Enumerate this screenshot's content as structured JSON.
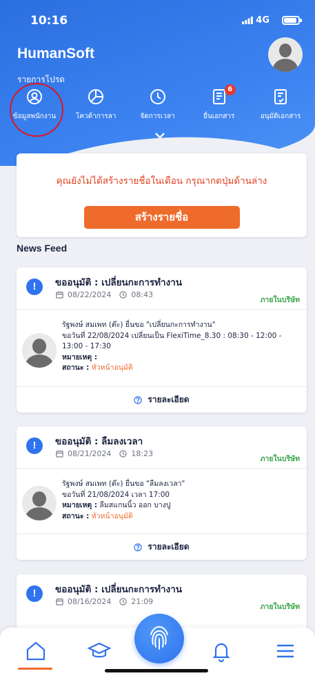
{
  "status_bar": {
    "time": "10:16",
    "network": "4G"
  },
  "header": {
    "brand": "HumanSoft",
    "favorites_label": "รายการโปรด",
    "shortcuts": [
      {
        "label": "ข้อมูลพนักงาน",
        "icon": "user-circle-icon"
      },
      {
        "label": "โควต้าการลา",
        "icon": "pie-chart-icon"
      },
      {
        "label": "จัดการเวลา",
        "icon": "clock-icon"
      },
      {
        "label": "ยื่นเอกสาร",
        "icon": "document-icon",
        "badge": "6"
      },
      {
        "label": "อนุมัติเอกสาร",
        "icon": "approve-document-icon"
      }
    ],
    "expand_icon": "chevron-down-icon"
  },
  "notice": {
    "message": "คุณยังไม่ได้สร้างรายชื่อในเดือน กรุณากดปุ่มด้านล่าง",
    "button": "สร้างรายชื่อ"
  },
  "news_feed": {
    "title": "News Feed",
    "items": [
      {
        "title": "ขออนุมัติ : เปลี่ยนกะการทำงาน",
        "date": "08/22/2024",
        "time": "08:43",
        "tag": "ภายในบริษัท",
        "line1": "รัฐพงษ์ สมเพท (ต๊ะ) ยื่นขอ \"เปลี่ยนกะการทำงาน\"",
        "line2": "ขอวันที่ 22/08/2024 เปลี่ยนเป็น FlexiTime_8.30 : 08:30 - 12:00 - 13:00 - 17:30",
        "remark_label": "หมายเหตุ :",
        "remark_value": "",
        "status_label": "สถานะ :",
        "status_value": "หัวหน้าอนุมัติ",
        "details": "รายละเอียด"
      },
      {
        "title": "ขออนุมัติ : ลืมลงเวลา",
        "date": "08/21/2024",
        "time": "18:23",
        "tag": "ภายในบริษัท",
        "line1": "รัฐพงษ์ สมเพท (ต๊ะ) ยื่นขอ \"ลืมลงเวลา\"",
        "line2": "ขอวันที่ 21/08/2024 เวลา 17:00",
        "remark_label": "หมายเหตุ :",
        "remark_value": "ลืมสแกนนิ้ว ออก บางปู",
        "status_label": "สถานะ :",
        "status_value": "หัวหน้าอนุมัติ",
        "details": "รายละเอียด"
      },
      {
        "title": "ขออนุมัติ : เปลี่ยนกะการทำงาน",
        "date": "08/16/2024",
        "time": "21:09",
        "tag": "ภายในบริษัท"
      }
    ]
  },
  "tab_bar": {
    "items": [
      "home-icon",
      "graduation-cap-icon",
      "fingerprint-icon",
      "bell-icon",
      "menu-icon"
    ],
    "active": "home-icon"
  },
  "colors": {
    "primary": "#2f73ee",
    "accent": "#ef6b2b",
    "tag": "#3aa54a",
    "highlight": "#e0141e"
  }
}
